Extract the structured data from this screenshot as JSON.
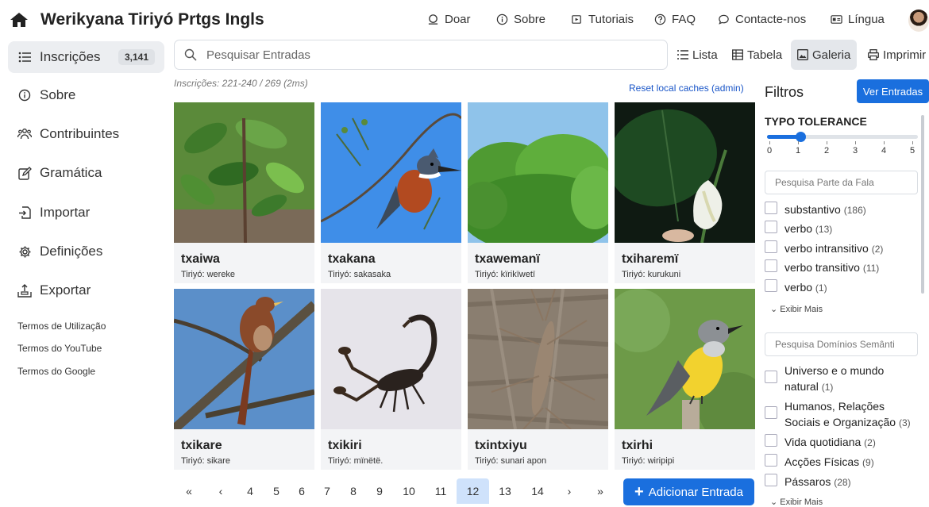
{
  "app": {
    "title": "Werikyana Tiriyó Prtgs Ingls"
  },
  "topnav": [
    {
      "label": "Doar",
      "icon": "donate-icon"
    },
    {
      "label": "Sobre",
      "icon": "info-icon"
    },
    {
      "label": "Tutoriais",
      "icon": "video-icon"
    },
    {
      "label": "FAQ",
      "icon": "question-icon"
    },
    {
      "label": "Contacte-nos",
      "icon": "chat-icon"
    },
    {
      "label": "Língua",
      "icon": "language-icon"
    }
  ],
  "sidebar": {
    "items": [
      {
        "label": "Inscrições",
        "badge": "3,141",
        "icon": "list-icon"
      },
      {
        "label": "Sobre",
        "icon": "info-icon"
      },
      {
        "label": "Contribuintes",
        "icon": "people-icon"
      },
      {
        "label": "Gramática",
        "icon": "edit-icon"
      },
      {
        "label": "Importar",
        "icon": "import-icon"
      },
      {
        "label": "Definições",
        "icon": "settings-icon"
      },
      {
        "label": "Exportar",
        "icon": "export-icon"
      }
    ],
    "links": [
      "Termos de Utilização",
      "Termos do YouTube",
      "Termos do Google"
    ]
  },
  "search": {
    "placeholder": "Pesquisar Entradas"
  },
  "views": [
    {
      "label": "Lista",
      "icon": "list-view-icon"
    },
    {
      "label": "Tabela",
      "icon": "table-icon"
    },
    {
      "label": "Galeria",
      "icon": "gallery-icon",
      "active": true
    },
    {
      "label": "Imprimir",
      "icon": "print-icon"
    }
  ],
  "results": {
    "info": "Inscrições: 221-240 / 269 (2ms)",
    "reset": "Reset local caches (admin)"
  },
  "cards": [
    {
      "word": "txaiwa",
      "gloss": "Tiriyó: wereke",
      "image": "plant-leaves"
    },
    {
      "word": "txakana",
      "gloss": "Tiriyó: sakasaka",
      "image": "kingfisher-bird"
    },
    {
      "word": "txawemanï",
      "gloss": "Tiriyó: kïrikïwetï",
      "image": "tree-canopy"
    },
    {
      "word": "txiharemï",
      "gloss": "Tiriyó: kurukuni",
      "image": "white-flower"
    },
    {
      "word": "txikare",
      "gloss": "Tiriyó: sikare",
      "image": "cuckoo-bird"
    },
    {
      "word": "txikiri",
      "gloss": "Tiriyó: mïnëtë.",
      "image": "scorpion"
    },
    {
      "word": "txintxiyu",
      "gloss": "Tiriyó: sunari apon",
      "image": "stick-insect"
    },
    {
      "word": "txirhi",
      "gloss": "Tiriyó: wiripipi",
      "image": "kingbird"
    }
  ],
  "pagination": {
    "first": "«",
    "prev": "‹",
    "pages": [
      "4",
      "5",
      "6",
      "7",
      "8",
      "9",
      "10",
      "11",
      "12",
      "13",
      "14"
    ],
    "current": "12",
    "next": "›",
    "last": "»"
  },
  "add_button": "Adicionar Entrada",
  "filters": {
    "title": "Filtros",
    "ver_entradas": "Ver Entradas",
    "typo_title": "TYPO TOLERANCE",
    "typo_value": 1,
    "typo_ticks": [
      "0",
      "1",
      "2",
      "3",
      "4",
      "5"
    ],
    "pos_placeholder": "Pesquisa Parte da Fala",
    "pos_options": [
      {
        "label": "substantivo",
        "count": "(186)"
      },
      {
        "label": "verbo",
        "count": "(13)"
      },
      {
        "label": "verbo intransitivo",
        "count": "(2)"
      },
      {
        "label": "verbo transitivo",
        "count": "(11)"
      },
      {
        "label": "verbo",
        "count": "(1)"
      }
    ],
    "show_more": "Exibir Mais",
    "domain_placeholder": "Pesquisa Domínios Semânti",
    "domain_options": [
      {
        "label": "Universo e o mundo natural",
        "count": "(1)"
      },
      {
        "label": "Humanos, Relações Sociais e Organização",
        "count": "(3)"
      },
      {
        "label": "Vida quotidiana",
        "count": "(2)"
      },
      {
        "label": "Acções Físicas",
        "count": "(9)"
      },
      {
        "label": "Pássaros",
        "count": "(28)"
      }
    ],
    "show_more_2": "Exibir Mais"
  },
  "colors": {
    "accent": "#1a6fde",
    "active_page": "#cfe2fb"
  }
}
